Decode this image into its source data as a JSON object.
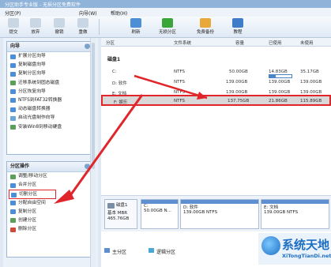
{
  "window": {
    "title": "分区助手专业版 - 无损分区免费软件"
  },
  "menu": [
    {
      "label": "分区(P)"
    },
    {
      "label": "向导(W)"
    },
    {
      "label": "帮助(H)"
    }
  ],
  "toolbar": [
    {
      "label": "提交",
      "icon": "commit-icon"
    },
    {
      "label": "放弃",
      "icon": "discard-icon"
    },
    {
      "label": "撤销",
      "icon": "undo-icon"
    },
    {
      "label": "重做",
      "icon": "redo-icon"
    },
    {
      "label": "刷新",
      "icon": "refresh-icon"
    },
    {
      "label": "无损分区",
      "icon": "partition-icon"
    },
    {
      "label": "免费备份",
      "icon": "backup-icon"
    },
    {
      "label": "教程",
      "icon": "tutorial-icon"
    }
  ],
  "wizard_panel": {
    "title": "向导",
    "items": [
      {
        "label": "扩展分区向导"
      },
      {
        "label": "复制磁盘向导"
      },
      {
        "label": "复制分区向导"
      },
      {
        "label": "迁移系统到固态磁盘"
      },
      {
        "label": "分区恢复向导"
      },
      {
        "label": "NTFS到FAT32转换器"
      },
      {
        "label": "动态磁盘转换器"
      },
      {
        "label": "启动光盘制作向导"
      },
      {
        "label": "安装Win8到移动硬盘"
      }
    ]
  },
  "ops_panel": {
    "title": "分区操作",
    "items": [
      {
        "label": "调整/移动分区"
      },
      {
        "label": "合并分区"
      },
      {
        "label": "切割分区"
      },
      {
        "label": "分配自由空间"
      },
      {
        "label": "复制分区"
      },
      {
        "label": "创建分区"
      },
      {
        "label": "删除分区"
      }
    ]
  },
  "table": {
    "headers": [
      "分区",
      "文件系统",
      "容量",
      "已使用",
      "未使用"
    ],
    "disk_title": "磁盘1",
    "rows": [
      {
        "name": "C:",
        "fs": "NTFS",
        "capacity": "50.00GB",
        "used": "14.83GB",
        "free": "35.17GB",
        "usage": 0.3
      },
      {
        "name": "D: 软件",
        "fs": "NTFS",
        "capacity": "139.00GB",
        "used": "139.00GB",
        "free": "139.00GB",
        "usage": 0.05
      },
      {
        "name": "E: 文档",
        "fs": "NTFS",
        "capacity": "139.00GB",
        "used": "139.00GB",
        "free": "139.00GB",
        "usage": 0.05
      },
      {
        "name": "F: 娱乐",
        "fs": "NTFS",
        "capacity": "137.75GB",
        "used": "21.86GB",
        "free": "115.89GB",
        "usage": 0.16
      }
    ]
  },
  "diskmap": {
    "label": "磁盘1",
    "type": "基本 MBR",
    "size": "465.76GB",
    "parts": [
      {
        "name": "C:",
        "detail": "50.00GB N..."
      },
      {
        "name": "D: 软件",
        "detail": "139.00GB NTFS"
      },
      {
        "name": "E: 文档",
        "detail": "139.00GB NTFS"
      }
    ]
  },
  "legend": {
    "primary": "主分区",
    "logical": "逻辑分区"
  },
  "watermark": {
    "line1": "系统天地",
    "line2": "XiTongTianDi.net"
  },
  "colors": {
    "accent": "#4a86c7",
    "selection_border": "#e0262a",
    "arrow": "#e0262a"
  }
}
